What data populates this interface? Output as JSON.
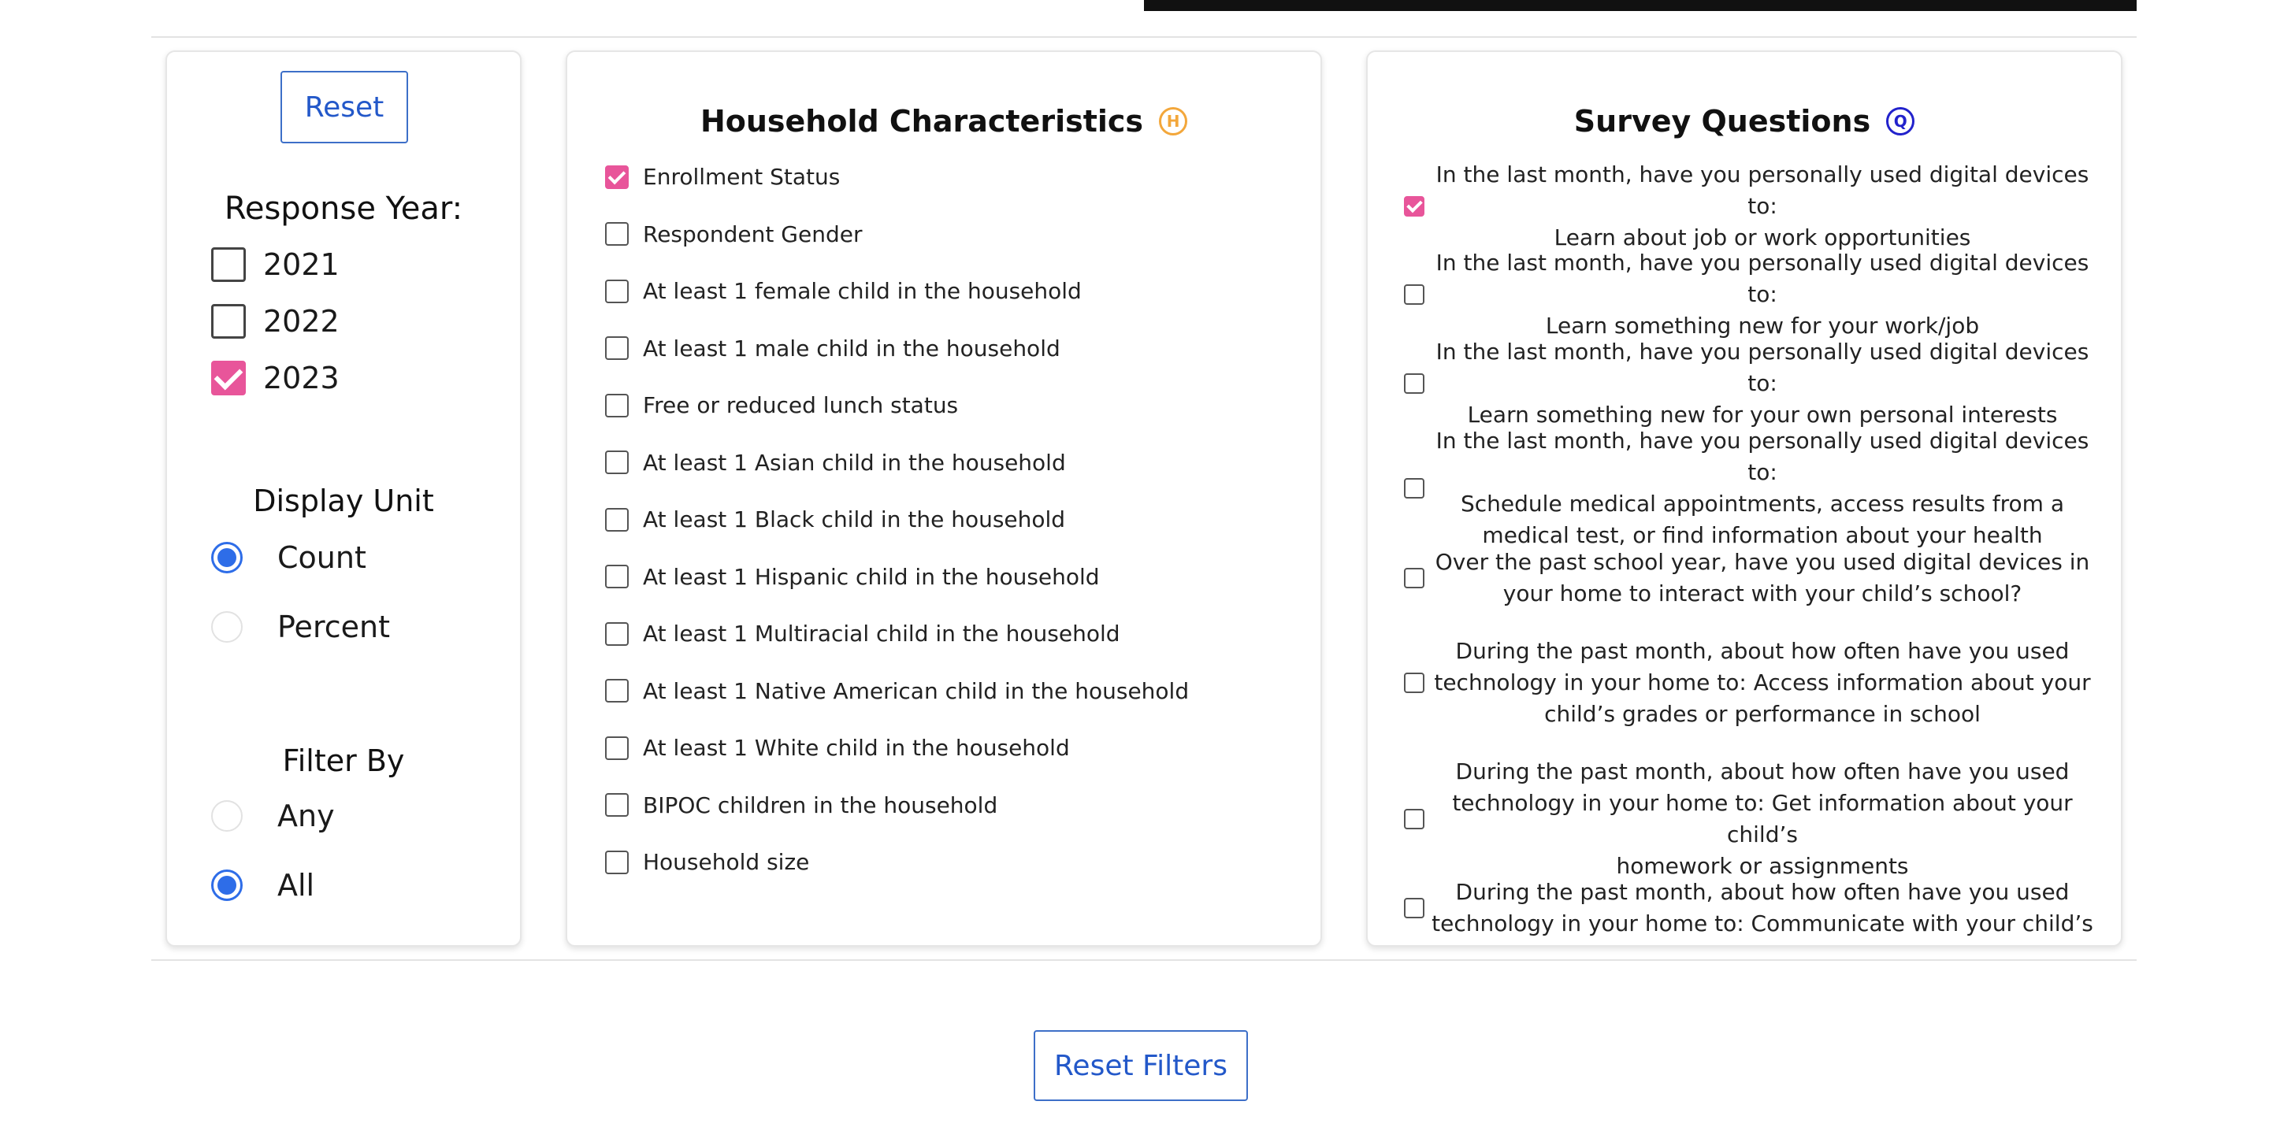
{
  "left_panel": {
    "reset_label": "Reset",
    "response_year": {
      "heading": "Response Year:",
      "options": [
        {
          "label": "2021",
          "checked": false
        },
        {
          "label": "2022",
          "checked": false
        },
        {
          "label": "2023",
          "checked": true
        }
      ]
    },
    "display_unit": {
      "heading": "Display Unit",
      "options": [
        {
          "label": "Count",
          "selected": true
        },
        {
          "label": "Percent",
          "selected": false
        }
      ]
    },
    "filter_by": {
      "heading": "Filter By",
      "options": [
        {
          "label": "Any",
          "selected": false
        },
        {
          "label": "All",
          "selected": true
        }
      ]
    }
  },
  "household": {
    "title": "Household Characteristics",
    "badge": "H",
    "items": [
      {
        "label": "Enrollment Status",
        "checked": true
      },
      {
        "label": "Respondent Gender",
        "checked": false
      },
      {
        "label": "At least 1 female child in the household",
        "checked": false
      },
      {
        "label": "At least 1 male child in the household",
        "checked": false
      },
      {
        "label": "Free or reduced lunch status",
        "checked": false
      },
      {
        "label": "At least 1 Asian child in the household",
        "checked": false
      },
      {
        "label": "At least 1 Black child in the household",
        "checked": false
      },
      {
        "label": "At least 1 Hispanic child in the household",
        "checked": false
      },
      {
        "label": "At least 1 Multiracial child in the household",
        "checked": false
      },
      {
        "label": "At least 1 Native American child in the household",
        "checked": false
      },
      {
        "label": "At least 1 White child in the household",
        "checked": false
      },
      {
        "label": "BIPOC children in the household",
        "checked": false
      },
      {
        "label": "Household size",
        "checked": false
      }
    ]
  },
  "survey": {
    "title": "Survey Questions",
    "badge": "Q",
    "items": [
      {
        "lines": [
          "In the last month, have you personally used digital devices to:",
          "Learn about job or work opportunities"
        ],
        "checked": true
      },
      {
        "lines": [
          "In the last month, have you personally used digital devices to:",
          "Learn something new for your work/job"
        ],
        "checked": false
      },
      {
        "lines": [
          "In the last month, have you personally used digital devices to:",
          "Learn something new for your own personal interests"
        ],
        "checked": false
      },
      {
        "lines": [
          "In the last month, have you personally used digital devices to:",
          "Schedule medical appointments, access results from a",
          "medical test, or find information about your health"
        ],
        "checked": false
      },
      {
        "lines": [
          "Over the past school year, have you used digital devices in",
          "your home to interact with your child’s school?"
        ],
        "checked": false
      },
      {
        "lines": [
          "During the past month, about how often have you used",
          "technology in your home to: Access information about your",
          "child’s grades or performance in school"
        ],
        "checked": false
      },
      {
        "lines": [
          "During the past month, about how often have you used",
          "technology in your home to: Get information about your child’s",
          "homework or assignments"
        ],
        "checked": false
      },
      {
        "lines": [
          "During the past month, about how often have you used",
          "technology in your home to: Communicate with your child’s"
        ],
        "checked": false
      }
    ]
  },
  "footer": {
    "reset_filters_label": "Reset Filters"
  }
}
